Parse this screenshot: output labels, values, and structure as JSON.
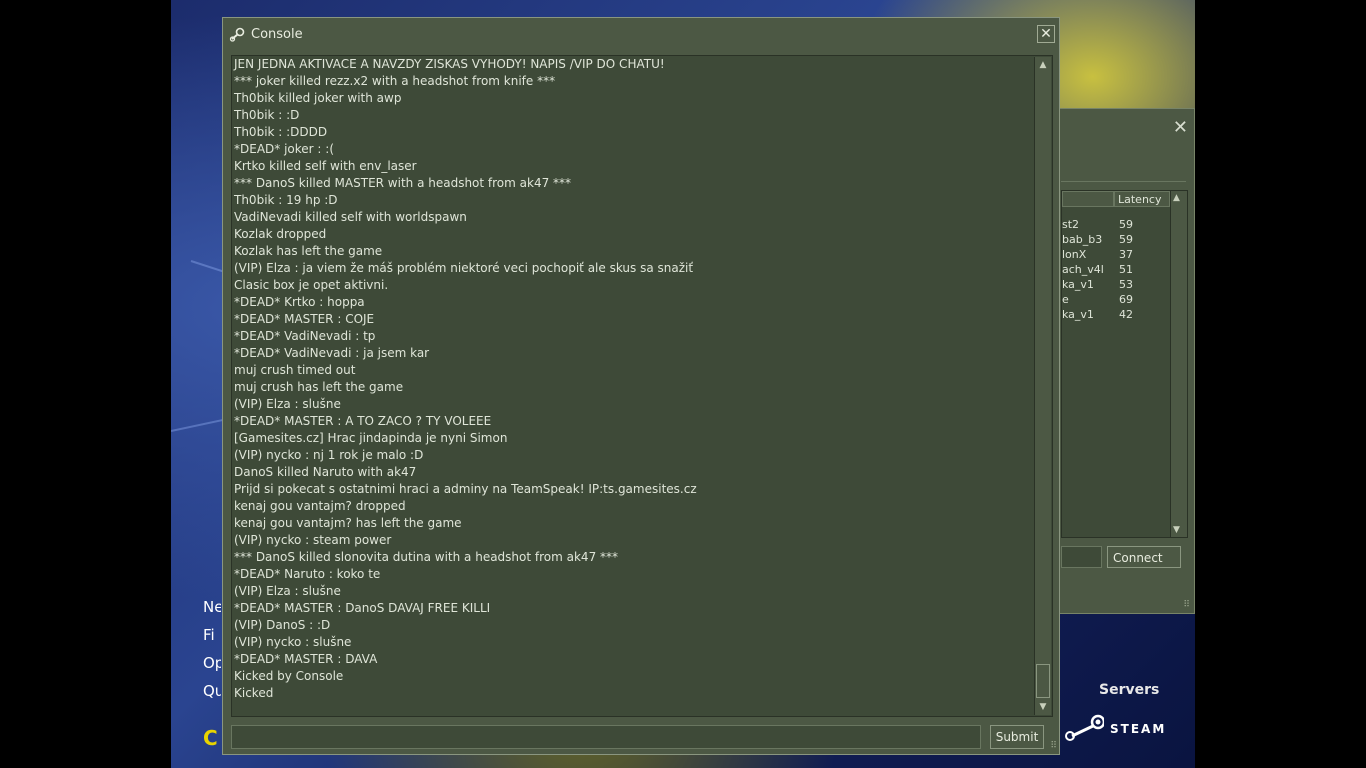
{
  "console": {
    "title": "Console",
    "close_glyph": "✕",
    "log": [
      "JEN JEDNA AKTIVACE A NAVZDY ZISKAS VYHODY! NAPIS /VIP DO CHATU!",
      "*** joker killed rezz.x2 with a headshot from knife ***",
      "Th0bik killed joker with awp",
      "Th0bik :  :D",
      "Th0bik :  :DDDD",
      "*DEAD* joker :  :(",
      "Krtko killed self with env_laser",
      "*** DanoS killed MASTER with a headshot from ak47 ***",
      "Th0bik :  19 hp :D",
      "VadiNevadi killed self with worldspawn",
      "Kozlak dropped",
      "Kozlak has left the game",
      "(VIP) Elza :  ja viem že máš problém niektoré veci pochopiť ale skus sa snažiť",
      "Clasic box je opet aktivni.",
      "*DEAD* Krtko :  hoppa",
      "*DEAD* MASTER :  COJE",
      "*DEAD* VadiNevadi :  tp",
      "*DEAD* VadiNevadi :  ja jsem kar",
      "muj crush timed out",
      "muj crush has left the game",
      "(VIP) Elza :  slušne",
      "*DEAD* MASTER :  A TO ZACO ? TY VOLEEE",
      "[Gamesites.cz] Hrac jindapinda je nyni Simon",
      "(VIP) nycko :  nj 1 rok je malo :D",
      "DanoS killed Naruto with ak47",
      "Prijd si pokecat s ostatnimi hraci a adminy na TeamSpeak! IP:ts.gamesites.cz",
      "kenaj gou vantajm? dropped",
      "kenaj gou vantajm? has left the game",
      "(VIP) nycko :  steam power",
      "*** DanoS killed slonovita dutina with a headshot from ak47 ***",
      "*DEAD* Naruto :  koko te",
      "(VIP) Elza :  slušne",
      "*DEAD* MASTER :  DanoS DAVAJ FREE KILLI",
      "(VIP) DanoS :  :D",
      "(VIP) nycko :  slušne",
      "*DEAD* MASTER :  DAVA",
      "Kicked by Console",
      "Kicked"
    ],
    "input_value": "",
    "submit_label": "Submit"
  },
  "servers_window": {
    "close_glyph": "✕",
    "latency_header": "Latency",
    "rows": [
      {
        "map": "st2",
        "latency": "59"
      },
      {
        "map": "bab_b3",
        "latency": "59"
      },
      {
        "map": "lonX",
        "latency": "37"
      },
      {
        "map": "ach_v4l",
        "latency": "51"
      },
      {
        "map": "ka_v1",
        "latency": "53"
      },
      {
        "map": "e",
        "latency": "69"
      },
      {
        "map": "ka_v1",
        "latency": "42"
      }
    ],
    "connect_label": "Connect"
  },
  "main_menu": {
    "items": [
      "Ne",
      "Fi",
      "Op",
      "Qu"
    ],
    "logo_text": "C"
  },
  "servers_label": "Servers",
  "steam_label": "STEAM",
  "colors": {
    "window_bg": "#4c5844",
    "panel_bg": "#3e4a38",
    "text": "#dfe5d8",
    "menu_text": "#ffffff",
    "logo_yellow": "#e8d400"
  }
}
